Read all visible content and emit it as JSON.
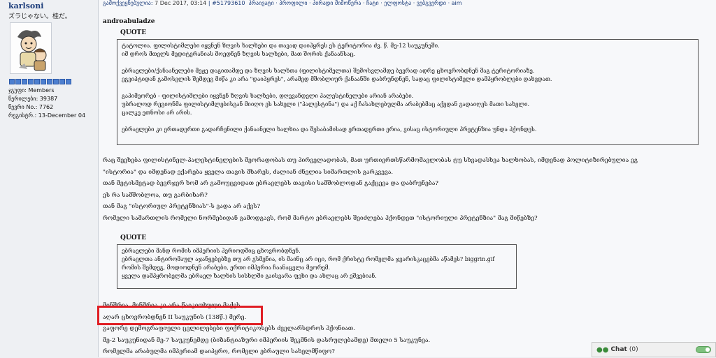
{
  "user": {
    "name": "karlsoni",
    "title": "ズラじゃない。桂だ。",
    "avatar_icon": "cartoon-kids-avatar-icon",
    "stats": [
      "ჯგუფი: Members",
      "წერილები: 39387",
      "წევრი No.: 7762",
      "რეგისტრ.: 13-December 04"
    ]
  },
  "post": {
    "header_prefix": "გამოქვეყნებულია:",
    "date": "7 Dec 2017, 03:14",
    "post_number": "#51793610",
    "header_links": "პრაივატი · პროფილი · პირადი მიმოწერა · ჩატი · ელფოსტა · ვებგვერდი · aim",
    "quote_author": "androabuladze",
    "quote_label_1": "QUOTE",
    "quote1_lines": [
      "ტატოლია. ფილისტიმლები იყვნენ ზღვის ხალხები და თავად დაიპყრეს ეს ტერიტორია ძვ. წ. მე-12 საუკუნეში.",
      "იმ დროს მთელს მედიტერანიას მოედნენ ზღვის ხალხები, მათ შორის ქანაანსაც.",
      "",
      "ებრაელები/ქანაანელები მეჟე დაგითამდე და ზღვის ხალხთა (ფილისტიმელთა) შემოსვლამდე ბევრად ადრე ცხოვრობდნენ მაგ ტერიტორიაზე.",
      "ეგვიპტიდან გამოსვლის შემდეგ მიწა კი არა \"დაიპყრეს\", არამედ მშობლიურ ქანაანში დაბრუნდნენ, სადაც ფილისტიმელი დამპყრობლები დახვდათ.",
      "",
      "გაპიმეორებ - ფილისტიმლები იყვნენ ზღვის ხალხები, დღევანდელი პალესტინელები არიან არაბები.",
      "უბრალოდ რეგიონმა ფილისტიმლებისგან მიიღო ეს სახელი (\"პალესტინა\") და აქ ჩასახლებულმა არაბებმაც აქედან გადაიღეს მათი სახელი.",
      "ცალკე ეთნოსი არ არის.",
      "",
      "ებრაელები კი ერთადერთი გადარჩენილი ქანაანელი ხალხია და შესაბამისად ერთადერთი ერია, ვისაც ისტორიული პრეტენზია უნდა ჰქონდეს."
    ],
    "body_lines_1": [
      "რაც შეეხება ფილისტინელ-პალესტინელების მეორადობას თუ პირველადობას, მათ ურთიერთსწარმომავლობას ტუ სხვადასხვა ხალხობას, იმდენად პოლიტიზირებულია ეგ",
      "\"ისტორია\" და იმდენად ექარება ყველა თავის მხარეს, ძალიან ძნელია სიმართლის გარკვევა.",
      "თან მეტისმეტად ბევრჯერ ხომ არ გამოუცვიდათ ებრაელებს თავისი სამშობლოდან გაქცევა და დაბრუნება?",
      "ეს რა სამშობლოა, თუ გარბიხარ?",
      "თან მაგ \"ისტორიულ პრეტენზიას\"-ს ვადა არ აქვს?",
      "რომელი სამართლის რომელი ნორმებიდან გამოდგავს, რომ მარტო ებრაელებს შეიძლება ჰქონდეთ \"ისტორიული პრეტენზია\" მაგ მიწებზე?"
    ],
    "quote_label_2": "QUOTE",
    "quote2_lines": [
      "ებრაელები მანდ რომის იმპერიის პერიოდშიც ცხოვრობდნენ.",
      "ებრაელთა ანტირომაულ აჯანყებებზე თუ არ გსმენია, ის მაინც არ იცი, რომ ქრისტე რომელმა ჯვარისკაცებმა აწამეს? biggrin.gif",
      "რომის შემდეგ, მოდიოდნენ არაბები, ერთი იმპერია ჩაანაცვლა მეორემ.",
      "ყველა დამპყრობელმა ებრაელ ხალხის სისხლში გაისვარა ფეხი და ახლაც არ ეშვებიან."
    ],
    "body_lines_2": [
      "მინშრია, მინშრია კი არა წაიკითხული მაქვს.",
      "აღარ ცხოვრობდნენ II საუკუნის (138წ.) მერე.",
      "გაფორე დემოგრაფიული ცვლილებები ფიქრიტიკოსებს ძველარსდროს ჰქონიათ.",
      "მე-2 საუკუნიდან მე-7 საუკუნემდე (ბიზანტიაზური იმპერიის შეკმნის დასრულებამდე) მთელი 5 საუკუნეა.",
      "რომელმა არაბულმა იმპერიამ დაიპყრო, რომელი ებრაული სახელმწიფო?"
    ]
  },
  "chat": {
    "label": "Chat",
    "count": "(0)",
    "icon": "chat-users-icon"
  },
  "colors": {
    "highlight": "#e01e24",
    "link": "#1b3c7a"
  }
}
